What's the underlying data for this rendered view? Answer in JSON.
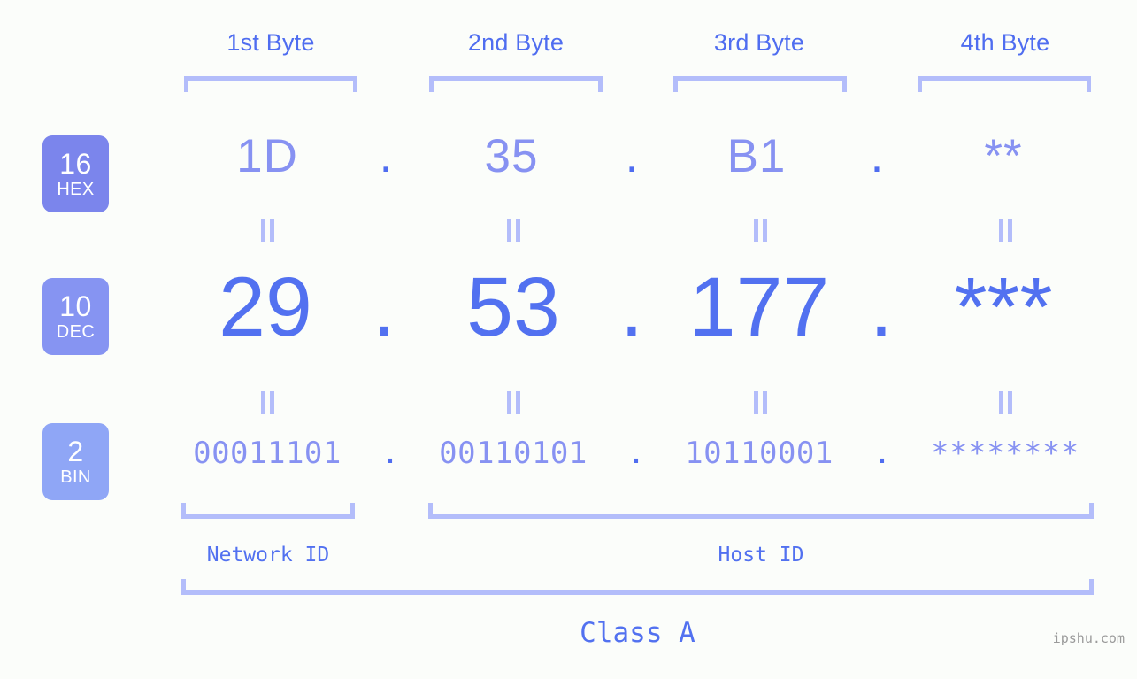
{
  "page": {
    "background_color": "#fbfdfa",
    "accent_color": "#5271f0",
    "light_accent_color": "#8792f2",
    "bracket_color": "#b3bdfa",
    "watermark": "ipshu.com"
  },
  "byte_headers": [
    {
      "label": "1st Byte"
    },
    {
      "label": "2nd Byte"
    },
    {
      "label": "3rd Byte"
    },
    {
      "label": "4th Byte"
    }
  ],
  "rows": [
    {
      "badge_base": "16",
      "badge_name": "HEX",
      "badge_color": "#7b85ec",
      "values": [
        "1D",
        "35",
        "B1",
        "**"
      ],
      "separator": "."
    },
    {
      "badge_base": "10",
      "badge_name": "DEC",
      "badge_color": "#8694f2",
      "values": [
        "29",
        "53",
        "177",
        "***"
      ],
      "separator": "."
    },
    {
      "badge_base": "2",
      "badge_name": "BIN",
      "badge_color": "#8fa6f6",
      "values": [
        "00011101",
        "00110101",
        "10110001",
        "********"
      ],
      "separator": "."
    }
  ],
  "equals_marks": {
    "symbol": "||",
    "count_per_gap": 4
  },
  "id_sections": [
    {
      "label": "Network ID"
    },
    {
      "label": "Host ID"
    }
  ],
  "class_section": {
    "label": "Class A"
  }
}
